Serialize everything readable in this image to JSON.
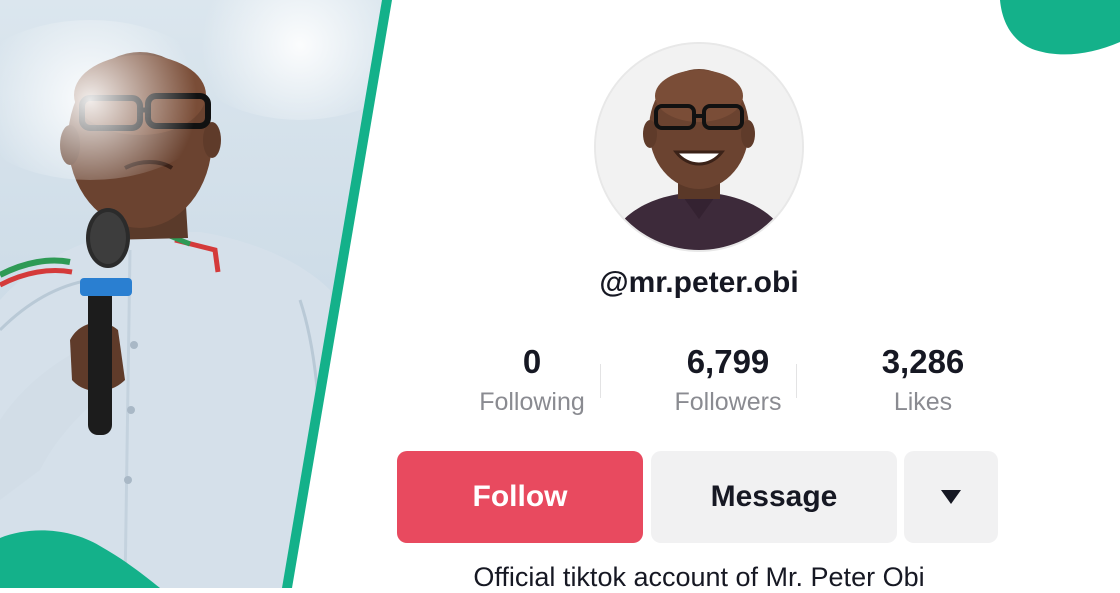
{
  "profile": {
    "username": "@mr.peter.obi",
    "avatar_alt": "Peter Obi profile photo",
    "bio": "Official tiktok account of Mr. Peter Obi"
  },
  "stats": {
    "following": {
      "value": "0",
      "label": "Following"
    },
    "followers": {
      "value": "6,799",
      "label": "Followers"
    },
    "likes": {
      "value": "3,286",
      "label": "Likes"
    }
  },
  "actions": {
    "follow_label": "Follow",
    "message_label": "Message",
    "more_icon": "caret-down-icon"
  },
  "colors": {
    "accent_green": "#14b18a",
    "follow_red": "#e84a5f",
    "secondary_bg": "#f1f1f2",
    "text_dark": "#161823",
    "text_muted": "#8a8b91"
  }
}
